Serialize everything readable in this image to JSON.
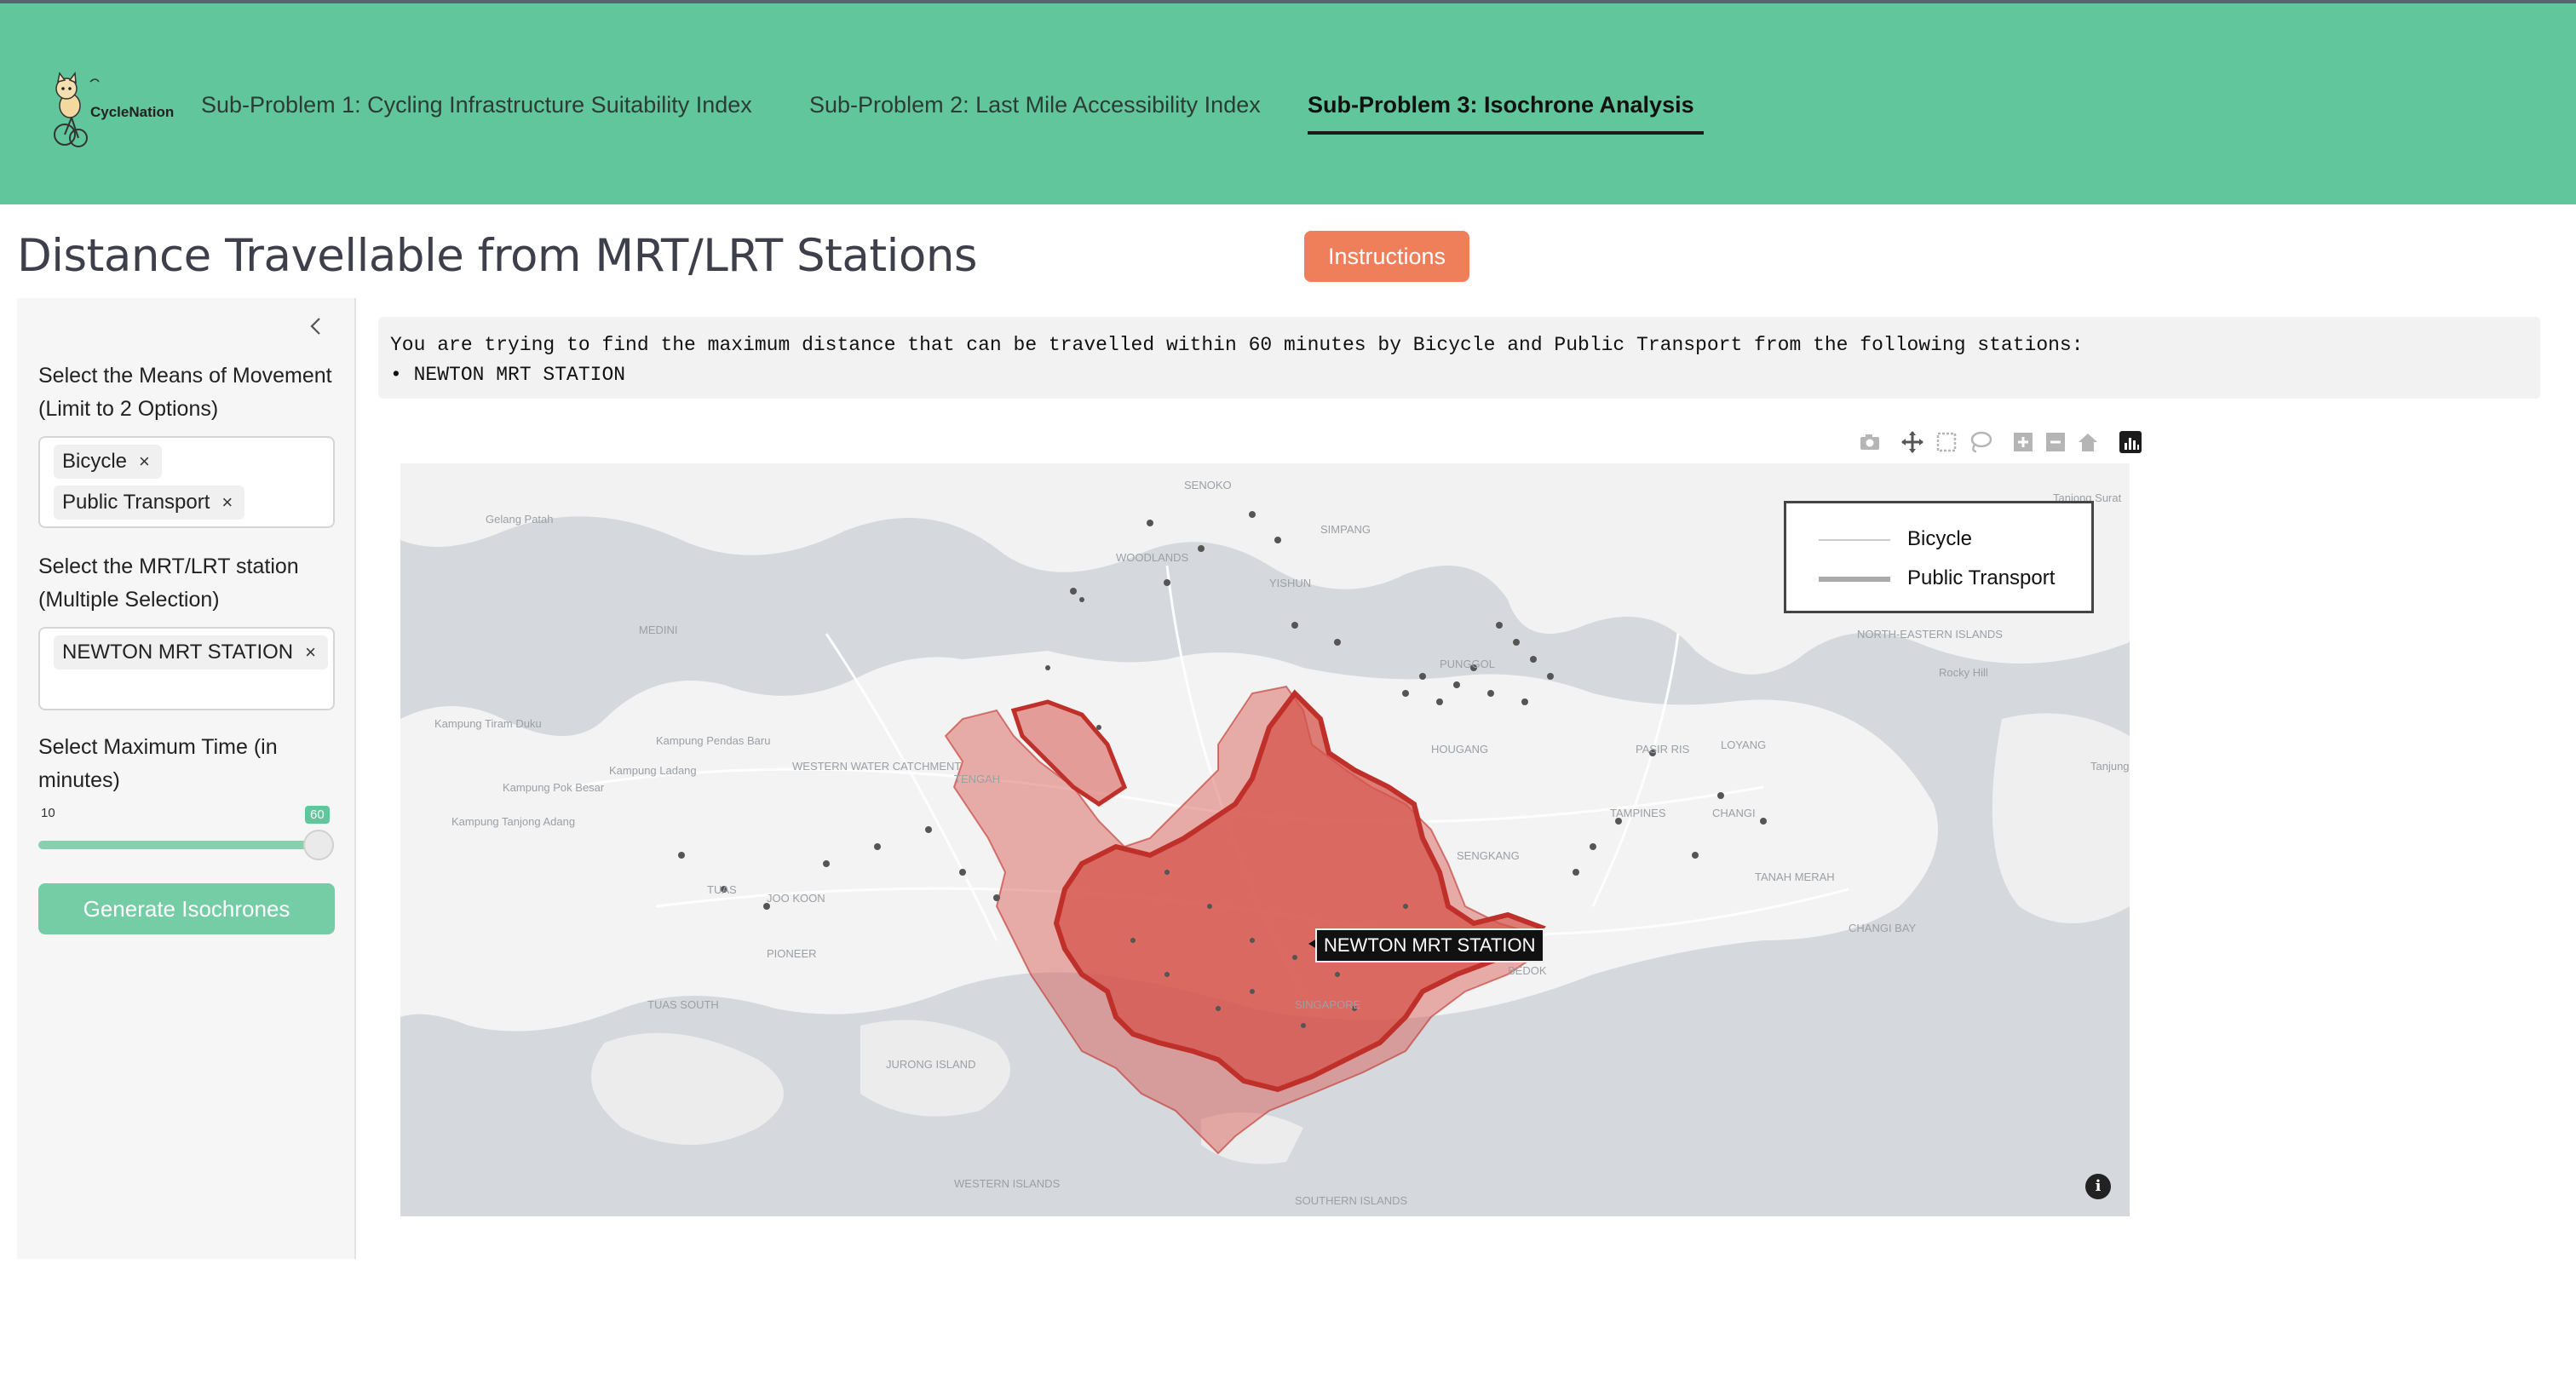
{
  "app": {
    "name": "CycleNation"
  },
  "nav": {
    "items": [
      {
        "label": "Sub-Problem 1: Cycling Infrastructure Suitability Index"
      },
      {
        "label": "Sub-Problem 2: Last Mile Accessibility Index"
      },
      {
        "label": "Sub-Problem 3: Isochrone Analysis",
        "active": true
      }
    ]
  },
  "page": {
    "title": "Distance Travellable from MRT/LRT Stations",
    "instructions_label": "Instructions"
  },
  "sidebar": {
    "means_label": "Select the Means of Movement (Limit to 2 Options)",
    "means_selected": [
      "Bicycle",
      "Public Transport"
    ],
    "station_label": "Select the MRT/LRT station (Multiple Selection)",
    "station_selected": [
      "NEWTON MRT STATION"
    ],
    "time_label": "Select Maximum Time (in minutes)",
    "time_min": "10",
    "time_max": "60",
    "time_value": 60,
    "generate_label": "Generate Isochrones",
    "chip_remove": "×"
  },
  "message": {
    "line1": "You are trying to find the maximum distance that can be travelled within 60 minutes by Bicycle and Public Transport from the following stations:",
    "line2": "• NEWTON MRT STATION"
  },
  "map": {
    "legend": [
      {
        "name": "Bicycle",
        "color": "#cccccc"
      },
      {
        "name": "Public Transport",
        "color": "#aaaaaa"
      }
    ],
    "station_label": "NEWTON MRT STATION",
    "isochrone_fill": "#d6534b",
    "isochrone_stroke": "#c0302a",
    "place_labels": [
      "Gelang Patah",
      "SENOKO",
      "WOODLANDS",
      "SIMPANG",
      "YISHUN",
      "MEDINI",
      "Kampung Tiram Duku",
      "Kampung Pendas Baru",
      "Kampung Ladang",
      "Kampung Pok Besar",
      "Kampung Tanjong Adang",
      "WESTERN WATER CATCHMENT",
      "TENGAH",
      "TUAS",
      "JOO KOON",
      "PIONEER",
      "TUAS SOUTH",
      "JURONG ISLAND",
      "WESTERN ISLANDS",
      "SOUTHERN ISLANDS",
      "SINGAPORE",
      "PUNGGOL",
      "PASIR RIS",
      "LOYANG",
      "TAMPINES",
      "CHANGI",
      "TANAH MERAH",
      "CHANGI BAY",
      "NORTH-EASTERN ISLANDS",
      "Rocky Hill",
      "Tanjong Surat",
      "Tanjung Pengelih",
      "HOUGANG",
      "SENGKANG",
      "BEDOK"
    ]
  },
  "modebar": {
    "icons": [
      "camera-icon",
      "pan-icon",
      "box-select-icon",
      "lasso-icon",
      "zoom-in-icon",
      "zoom-out-icon",
      "reset-home-icon",
      "plotly-logo-icon"
    ]
  },
  "colors": {
    "header": "#61c69b",
    "primary_button": "#ef7e5b",
    "generate_button": "#74cda5"
  }
}
